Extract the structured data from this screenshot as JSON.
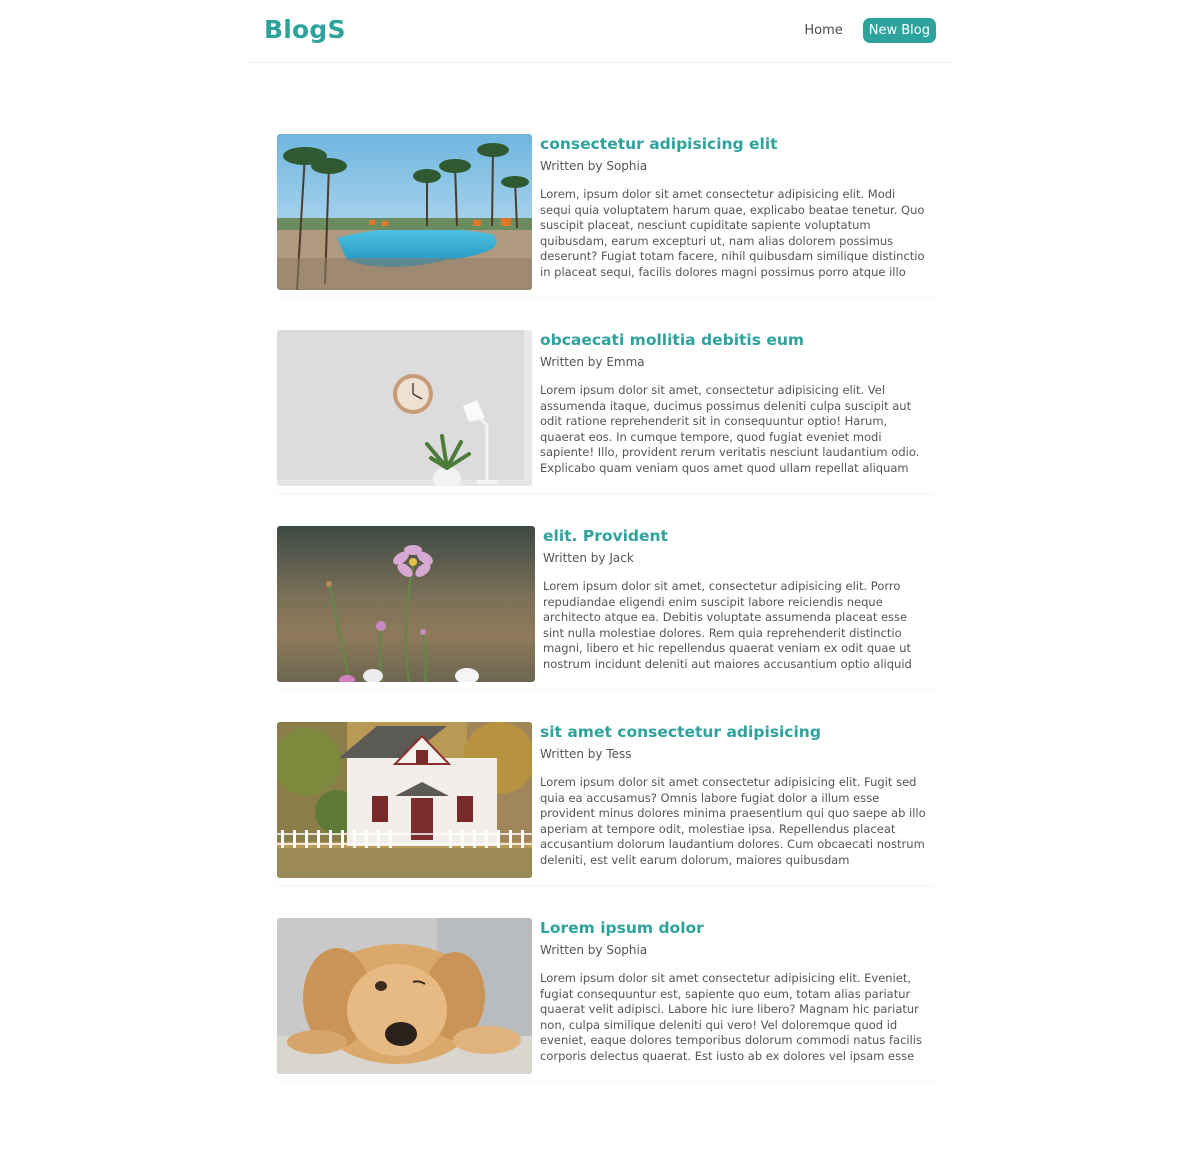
{
  "nav": {
    "brand": "BlogS",
    "home": "Home",
    "new_blog": "New Blog"
  },
  "blogs": [
    {
      "title": "consectetur adipisicing elit",
      "author": "Written by Sophia",
      "body": "Lorem, ipsum dolor sit amet consectetur adipisicing elit. Modi sequi quia voluptatem harum quae, explicabo beatae tenetur. Quo suscipit placeat, nesciunt cupiditate sapiente voluptatum quibusdam, earum excepturi ut, nam alias dolorem possimus deserunt? Fugiat totam facere, nihil quibusdam similique distinctio in placeat sequi, facilis dolores magni possimus porro atque illo",
      "image": "pool-resort-image"
    },
    {
      "title": "obcaecati mollitia debitis eum",
      "author": "Written by Emma",
      "body": "Lorem ipsum dolor sit amet, consectetur adipisicing elit. Vel assumenda itaque, ducimus possimus deleniti culpa suscipit aut odit ratione reprehenderit sit in consequuntur optio! Harum, quaerat eos. In cumque tempore, quod fugiat eveniet modi sapiente! Illo, provident rerum veritatis nesciunt laudantium odio. Explicabo quam veniam quos amet quod ullam repellat aliquam",
      "image": "clock-lamp-image"
    },
    {
      "title": "elit. Provident",
      "author": "Written by Jack",
      "body": "Lorem ipsum dolor sit amet, consectetur adipisicing elit. Porro repudiandae eligendi enim suscipit labore reiciendis neque architecto atque ea. Debitis voluptate assumenda placeat esse sint nulla molestiae dolores. Rem quia reprehenderit distinctio magni, libero et hic repellendus quaerat veniam ex odit quae ut nostrum incidunt deleniti aut maiores accusantium optio aliquid",
      "image": "pink-flower-image"
    },
    {
      "title": "sit amet consectetur adipisicing",
      "author": "Written by Tess",
      "body": "Lorem ipsum dolor sit amet consectetur adipisicing elit. Fugit sed quia ea accusamus? Omnis labore fugiat dolor a illum esse provident minus dolores minima praesentium qui quo saepe ab illo aperiam at tempore odit, molestiae ipsa. Repellendus placeat accusantium dolorum laudantium dolores. Cum obcaecati nostrum deleniti, est velit earum dolorum, maiores quibusdam",
      "image": "white-house-image"
    },
    {
      "title": "Lorem ipsum dolor",
      "author": "Written by Sophia",
      "body": "Lorem ipsum dolor sit amet consectetur adipisicing elit. Eveniet, fugiat consequuntur est, sapiente quo eum, totam alias pariatur quaerat velit adipisci. Labore hic iure libero? Magnam hic pariatur non, culpa similique deleniti qui vero! Vel doloremque quod id eveniet, eaque dolores temporibus dolorum commodi natus facilis corporis delectus quaerat. Est iusto ab ex dolores vel ipsam esse",
      "image": "puppy-image"
    }
  ]
}
